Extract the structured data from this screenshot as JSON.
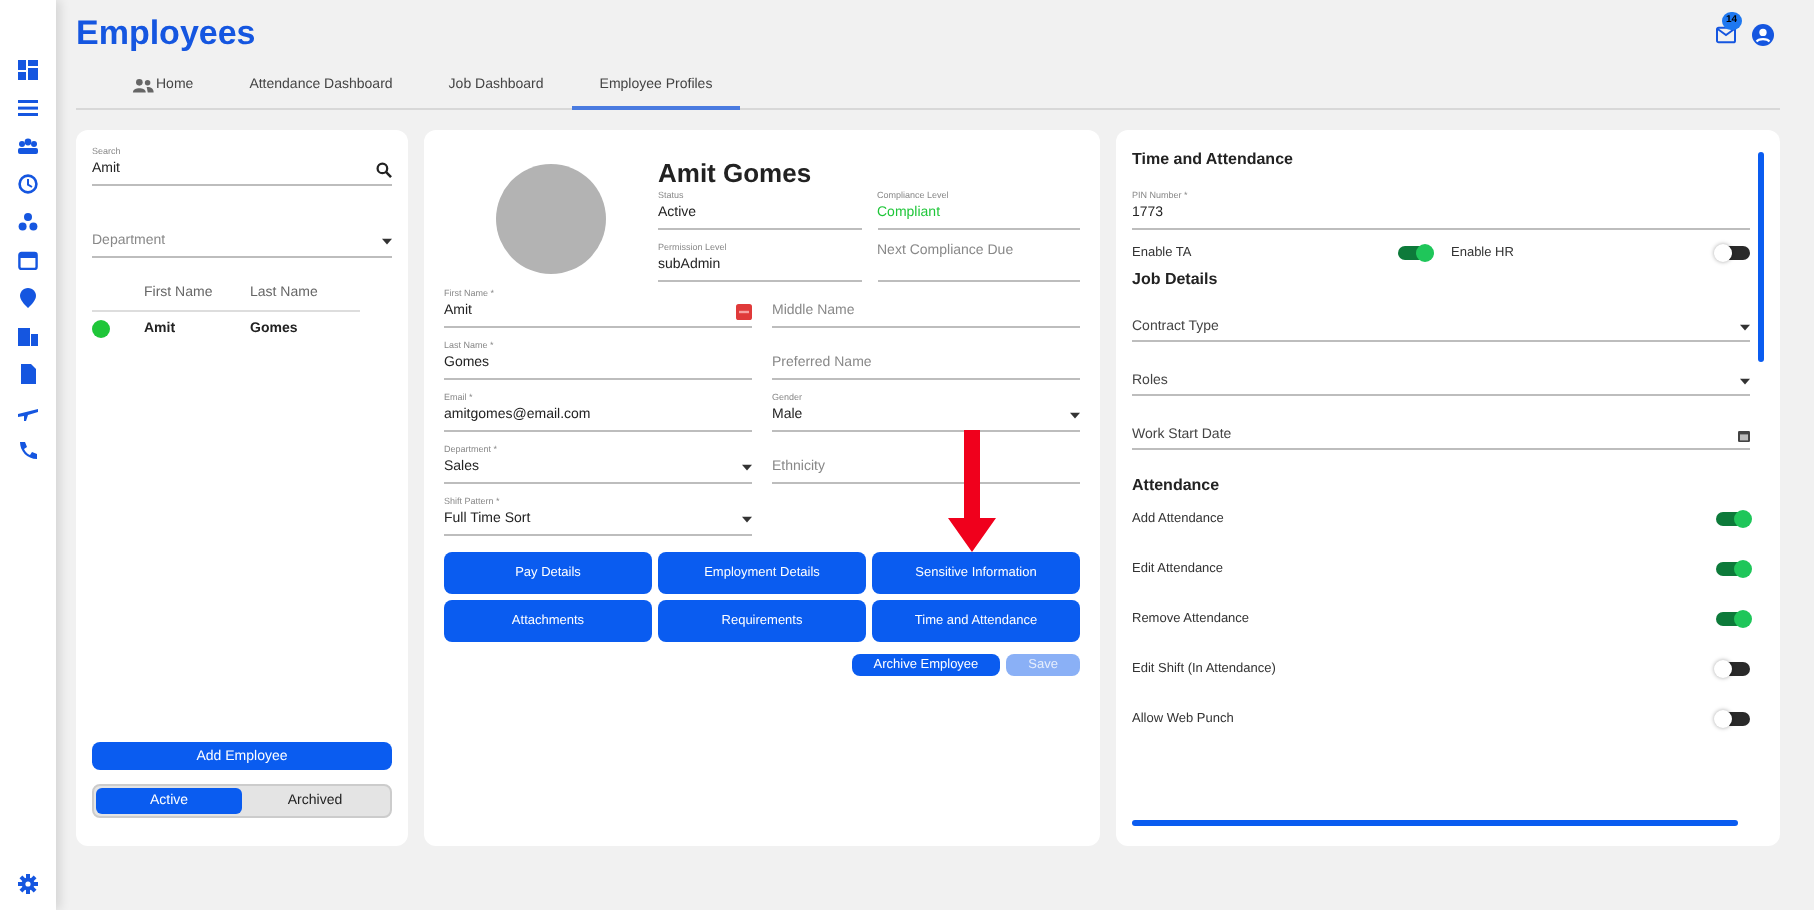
{
  "header": {
    "title": "Employees",
    "notification_count": "14"
  },
  "tabs": [
    {
      "label": "Home",
      "kind": "with-icon",
      "selected": false
    },
    {
      "label": "Attendance Dashboard",
      "kind": "plain",
      "selected": false
    },
    {
      "label": "Job Dashboard",
      "kind": "plain",
      "selected": false
    },
    {
      "label": "Employee Profiles",
      "kind": "plain",
      "selected": true
    }
  ],
  "employee_list": {
    "search": {
      "label": "Search",
      "value": "Amit"
    },
    "department": {
      "placeholder": "Department"
    },
    "columns": [
      "First Name",
      "Last Name"
    ],
    "rows": [
      {
        "first_name": "Amit",
        "last_name": "Gomes",
        "color": "#1fc639"
      }
    ],
    "add_button": "Add Employee",
    "filters": [
      {
        "label": "Active",
        "selected": true
      },
      {
        "label": "Archived",
        "selected": false
      }
    ]
  },
  "profile": {
    "name": "Amit Gomes",
    "summary_fields": [
      {
        "label": "Status",
        "value": "Active"
      },
      {
        "label": "Compliance Level",
        "value": "Compliant",
        "color": "#1fc639"
      },
      {
        "label": "Permission Level",
        "value": "subAdmin"
      },
      {
        "placeholder": "Next Compliance Due"
      }
    ],
    "fields": [
      {
        "label": "First Name *",
        "value": "Amit",
        "dropdown": false,
        "flag": true
      },
      {
        "placeholder": "Middle Name",
        "dropdown": false,
        "flag": false
      },
      {
        "label": "Last Name *",
        "value": "Gomes",
        "dropdown": false,
        "flag": false
      },
      {
        "placeholder": "Preferred Name",
        "dropdown": false,
        "flag": false
      },
      {
        "label": "Email *",
        "value": "amitgomes@email.com",
        "dropdown": false,
        "flag": false
      },
      {
        "label": "Gender",
        "value": "Male",
        "dropdown": true,
        "flag": false
      },
      {
        "label": "Department *",
        "value": "Sales",
        "dropdown": true,
        "flag": false
      },
      {
        "placeholder": "Ethnicity",
        "dropdown": false,
        "flag": false
      },
      {
        "label": "Shift Pattern *",
        "value": "Full Time Sort",
        "dropdown": true,
        "flag": false
      }
    ],
    "sections": [
      "Pay Details",
      "Employment Details",
      "Sensitive Information",
      "Attachments",
      "Requirements",
      "Time and Attendance"
    ],
    "actions": [
      {
        "label": "Archive Employee",
        "disabled": false
      },
      {
        "label": "Save",
        "disabled": true
      }
    ]
  },
  "time_attendance": {
    "title": "Time and Attendance",
    "pin": {
      "label": "PIN Number *",
      "value": "1773"
    },
    "enable_toggles": [
      {
        "label": "Enable TA",
        "on": true
      },
      {
        "label": "Enable HR",
        "on": false
      }
    ],
    "job_title": "Job Details",
    "job_fields": [
      {
        "placeholder": "Contract Type",
        "kind": "select"
      },
      {
        "placeholder": "Roles",
        "kind": "select"
      },
      {
        "placeholder": "Work Start Date",
        "kind": "date"
      }
    ],
    "attendance_title": "Attendance",
    "attendance": [
      {
        "label": "Add Attendance",
        "on": true
      },
      {
        "label": "Edit Attendance",
        "on": true
      },
      {
        "label": "Remove Attendance",
        "on": true
      },
      {
        "label": "Edit Shift (In Attendance)",
        "on": false
      },
      {
        "label": "Allow Web Punch",
        "on": false
      }
    ]
  }
}
